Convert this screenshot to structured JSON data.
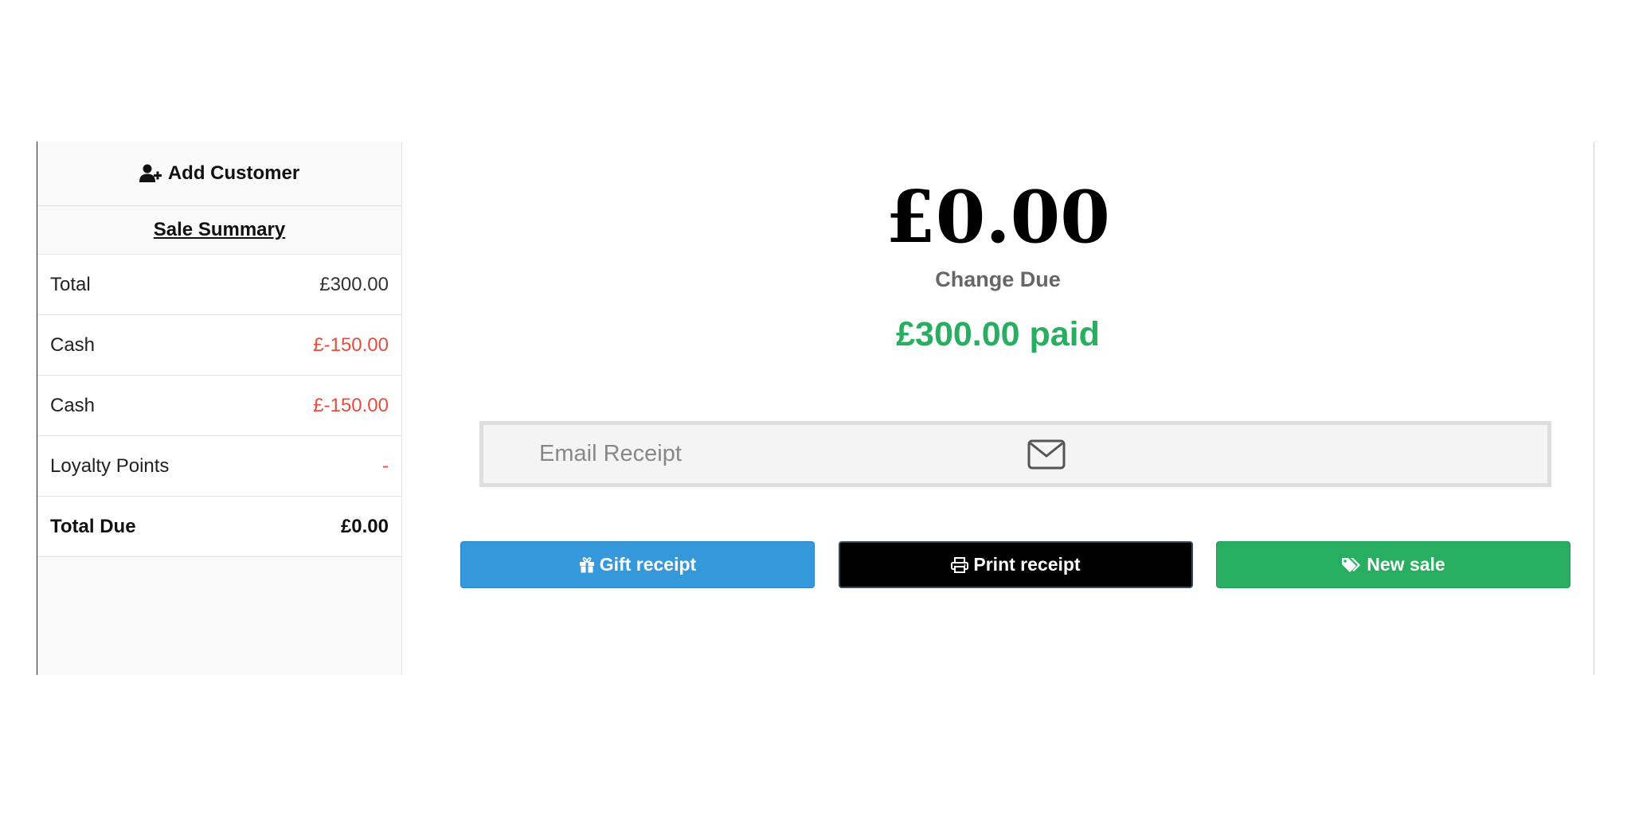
{
  "sidebar": {
    "add_customer_label": "Add Customer",
    "summary_title": "Sale Summary",
    "rows": [
      {
        "label": "Total",
        "value": "£300.00"
      },
      {
        "label": "Cash",
        "value": "£-150.00"
      },
      {
        "label": "Cash",
        "value": "£-150.00"
      },
      {
        "label": "Loyalty Points",
        "value": "-"
      }
    ],
    "total_due": {
      "label": "Total Due",
      "value": "£0.00"
    }
  },
  "main": {
    "change_amount": "£0.00",
    "change_label": "Change Due",
    "paid_text": "£300.00 paid",
    "email_placeholder": "Email Receipt",
    "buttons": {
      "gift": "Gift receipt",
      "print": "Print receipt",
      "new_sale": "New sale"
    }
  },
  "icons": {
    "add_customer": "user-plus-icon",
    "email": "envelope-icon",
    "gift": "gift-icon",
    "print": "printer-icon",
    "new_sale": "tags-icon"
  },
  "colors": {
    "negative": "#e74c3c",
    "paid": "#27ae60",
    "gift_button": "#3498db",
    "print_button": "#000000",
    "new_sale_button": "#27ae60"
  }
}
